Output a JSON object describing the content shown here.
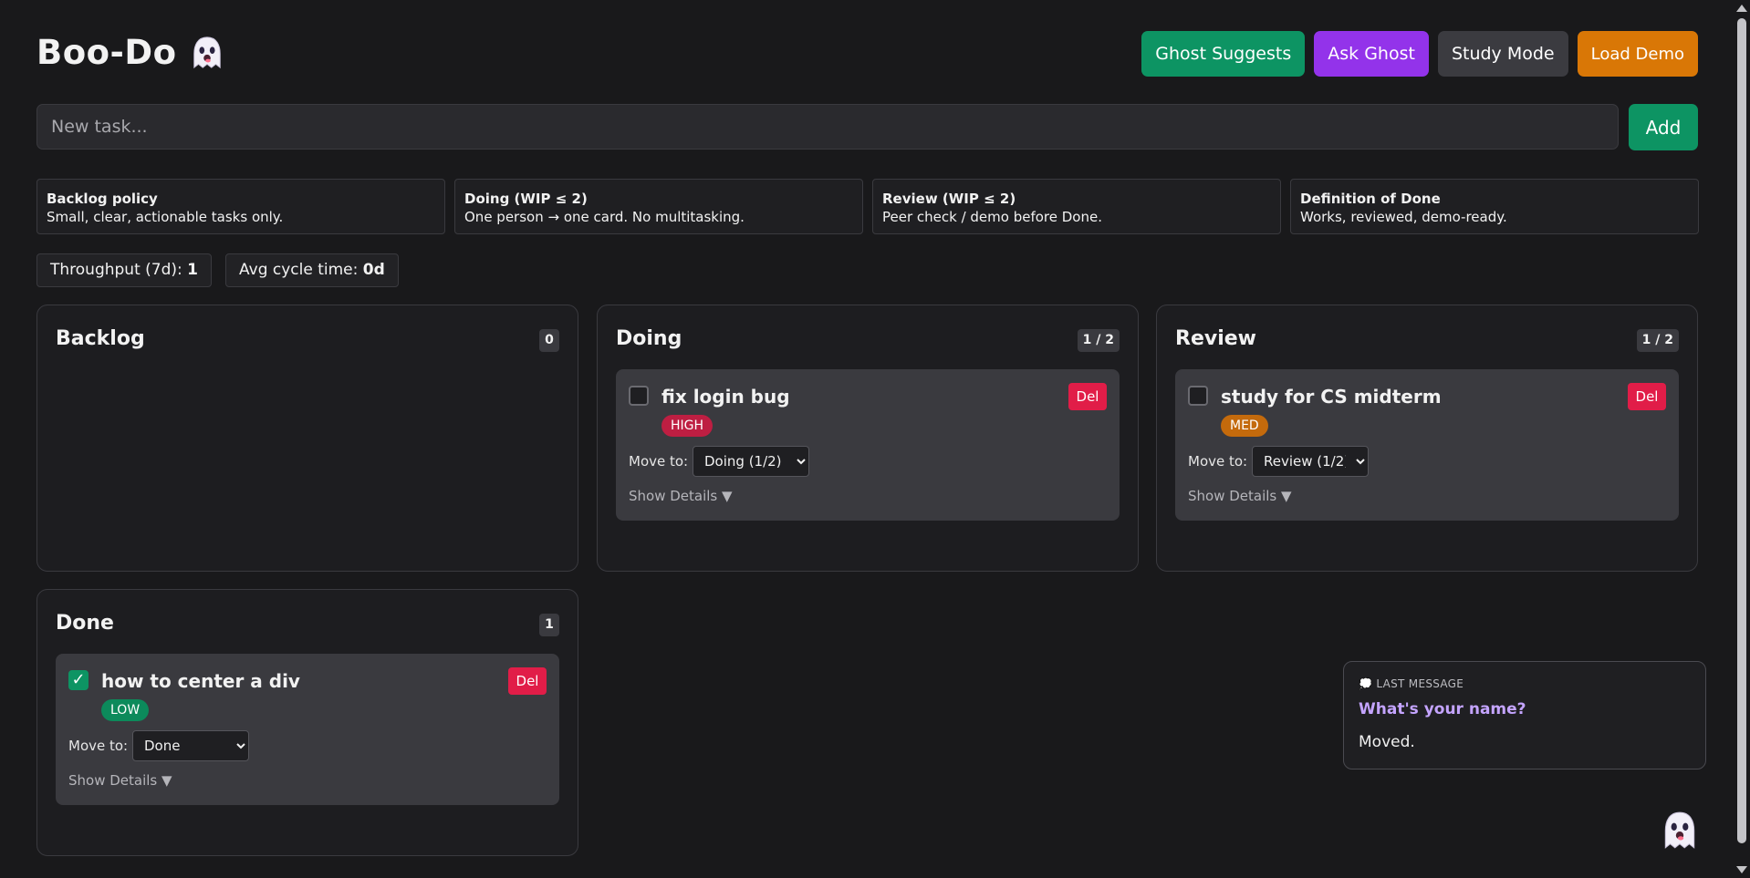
{
  "header": {
    "title": "Boo-Do",
    "buttons": {
      "ghost_suggests": "Ghost Suggests",
      "ask_ghost": "Ask Ghost",
      "study_mode": "Study Mode",
      "load_demo": "Load Demo"
    }
  },
  "new_task": {
    "placeholder": "New task...",
    "value": "",
    "add_label": "Add"
  },
  "policies": [
    {
      "title": "Backlog policy",
      "text": "Small, clear, actionable tasks only."
    },
    {
      "title": "Doing (WIP ≤ 2)",
      "text": "One person → one card. No multitasking."
    },
    {
      "title": "Review (WIP ≤ 2)",
      "text": "Peer check / demo before Done."
    },
    {
      "title": "Definition of Done",
      "text": "Works, reviewed, demo-ready."
    }
  ],
  "metrics": {
    "throughput_label": "Throughput (7d): ",
    "throughput_value": "1",
    "cycle_label": "Avg cycle time: ",
    "cycle_value": "0d"
  },
  "columns": {
    "backlog": {
      "title": "Backlog",
      "count": "0",
      "cards": []
    },
    "doing": {
      "title": "Doing",
      "count": "1 / 2",
      "cards": [
        {
          "title": "fix login bug",
          "priority": "HIGH",
          "checked": false,
          "move_label": "Move to:",
          "move_value": "Doing (1/2)",
          "details": "Show Details ▼",
          "del": "Del"
        }
      ]
    },
    "review": {
      "title": "Review",
      "count": "1 / 2",
      "cards": [
        {
          "title": "study for CS midterm",
          "priority": "MED",
          "checked": false,
          "move_label": "Move to:",
          "move_value": "Review (1/2)",
          "details": "Show Details ▼",
          "del": "Del"
        }
      ]
    },
    "done": {
      "title": "Done",
      "count": "1",
      "cards": [
        {
          "title": "how to center a div",
          "priority": "LOW",
          "checked": true,
          "check_mark": "✓",
          "move_label": "Move to:",
          "move_value": "Done",
          "details": "Show Details ▼",
          "del": "Del"
        }
      ]
    }
  },
  "chat": {
    "header": "💭 LAST MESSAGE",
    "question": "What's your name?",
    "answer": "Moved."
  },
  "icons": {
    "title_icon": "ghost-icon",
    "floating_icon": "ghost-icon"
  },
  "colors": {
    "background": "#19191b",
    "green": "#0d9463",
    "purple": "#9333ea",
    "orange": "#d97706",
    "danger": "#e11d48"
  }
}
